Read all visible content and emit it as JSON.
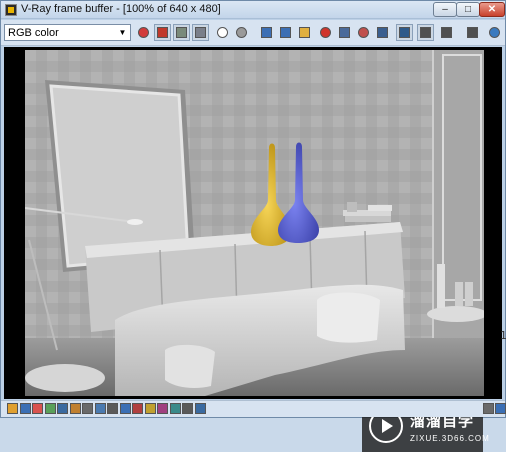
{
  "window": {
    "title": "V-Ray frame buffer - [100% of 640 x 480]",
    "minimize_glyph": "–",
    "maximize_glyph": "□",
    "close_glyph": "✕"
  },
  "toolbar": {
    "channel": {
      "selected": "RGB color",
      "chevron": "▼"
    },
    "buttons": [
      {
        "icon": "color-wheel-icon",
        "color": "#d23b3b"
      },
      {
        "icon": "red-channel-icon",
        "color": "#c0392b"
      },
      {
        "icon": "green-channel-icon",
        "color": "#7a8a7a"
      },
      {
        "icon": "blue-channel-icon",
        "color": "#7a7f8a"
      },
      {
        "icon": "alpha-white-icon",
        "color": "#ffffff"
      },
      {
        "icon": "mono-gray-icon",
        "color": "#9a9a9a"
      },
      {
        "icon": "save-icon",
        "color": "#3c6fb4"
      },
      {
        "icon": "save-all-icon",
        "color": "#3c6fb4"
      },
      {
        "icon": "open-folder-icon",
        "color": "#e0b040"
      },
      {
        "icon": "clear-icon",
        "color": "#d0352c"
      },
      {
        "icon": "duplicate-icon",
        "color": "#4a6a9a"
      },
      {
        "icon": "track-mouse-icon",
        "color": "#c0504d"
      },
      {
        "icon": "region-render-icon",
        "color": "#3a5f8f"
      },
      {
        "icon": "show-correction-icon",
        "color": "#2e5a8a"
      },
      {
        "icon": "levels-icon",
        "color": "#505050"
      },
      {
        "icon": "link-icon",
        "color": "#505050"
      },
      {
        "icon": "print-icon",
        "color": "#505050"
      },
      {
        "icon": "restore-icon",
        "color": "#3a7abf"
      }
    ]
  },
  "statusbar": {
    "buttons": [
      {
        "icon": "lens-effects-icon"
      },
      {
        "icon": "info-icon"
      },
      {
        "icon": "color-balance-icon"
      },
      {
        "icon": "curves-icon"
      },
      {
        "icon": "histogram-icon"
      },
      {
        "icon": "exposure-icon"
      },
      {
        "icon": "white-balance-icon"
      },
      {
        "icon": "stamp-icon"
      },
      {
        "icon": "compare-icon"
      },
      {
        "icon": "ab-compare-icon"
      },
      {
        "icon": "history-icon"
      },
      {
        "icon": "srgb-icon"
      },
      {
        "icon": "ocio-icon"
      },
      {
        "icon": "lut-icon"
      },
      {
        "icon": "pixel-aspect-icon"
      },
      {
        "icon": "zoom-icon"
      }
    ]
  },
  "side_text": "1",
  "watermark": {
    "brand_cn": "溜溜自学",
    "url": "ZIXUE.3D66.COM"
  },
  "scene": {
    "wall_color": "#b8b8b8",
    "floor_color": "#8e8e8e",
    "vase_yellow": "#e2b82a",
    "vase_blue": "#5560d8",
    "image_description": "rendered interior: framed mirror leaning on wall, shelf cabinet with yellow and blue vases and books, sofa with cushions, floor lamp, side table with glasses"
  }
}
